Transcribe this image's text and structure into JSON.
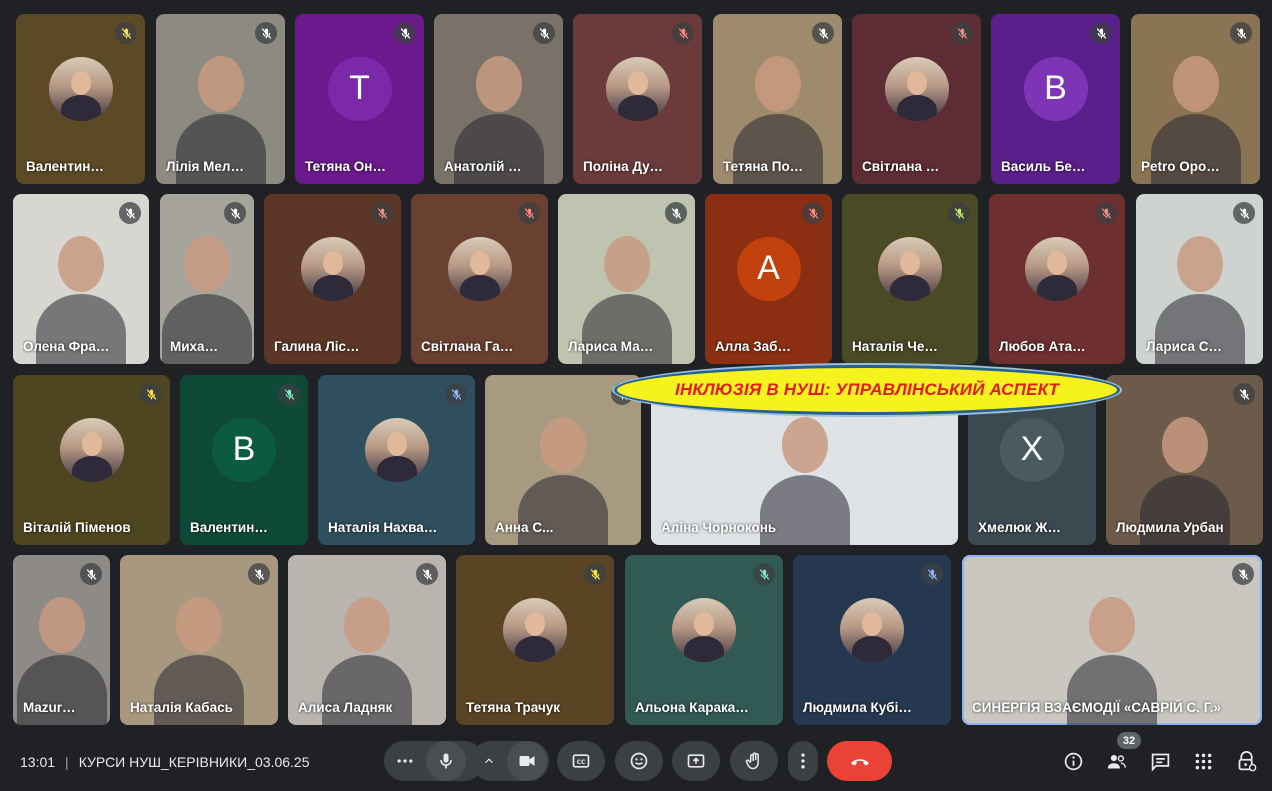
{
  "participants": [
    {
      "name": "Валентина ...",
      "color": "#5b4a25",
      "avatar": "photo-circle",
      "micColor": "#fce34d"
    },
    {
      "name": "Лілія Мельн...",
      "color": "#8d8a82",
      "avatar": "camera",
      "micColor": "#ffffff"
    },
    {
      "name": "Тетяна Оноп...",
      "color": "#6a1a8c",
      "avatar": "letter",
      "letter": "Т",
      "letterColor": "#7b29a8",
      "micColor": "#ffffff"
    },
    {
      "name": "Анатолій По...",
      "color": "#7a7268",
      "avatar": "camera",
      "micColor": "#ffffff"
    },
    {
      "name": "Поліна Дурд...",
      "color": "#6b3a3b",
      "avatar": "photo-circle",
      "micColor": "#f28b82"
    },
    {
      "name": "Тетяна Подо...",
      "color": "#9e8a6c",
      "avatar": "camera",
      "micColor": "#ffffff"
    },
    {
      "name": "Світлана Пе...",
      "color": "#5e2c35",
      "avatar": "photo-circle",
      "micColor": "#f28b82"
    },
    {
      "name": "Василь Безв...",
      "color": "#5a1f8a",
      "avatar": "letter",
      "letter": "В",
      "letterColor": "#7d35b5",
      "micColor": "#ffffff"
    },
    {
      "name": "Petro Opopri...",
      "color": "#8a7454",
      "avatar": "camera",
      "micColor": "#ffffff"
    },
    {
      "name": "Олена Франч...",
      "color": "#d8d6d0",
      "avatar": "camera",
      "micColor": "#ffffff"
    },
    {
      "name": "Михайл...",
      "color": "#a7a49c",
      "avatar": "camera",
      "micColor": "#ffffff"
    },
    {
      "name": "Галина Лісник",
      "color": "#5c3626",
      "avatar": "photo-circle",
      "micColor": "#f28b82"
    },
    {
      "name": "Світлана Гавр...",
      "color": "#6a4030",
      "avatar": "photo-circle",
      "micColor": "#f28b82"
    },
    {
      "name": "Лариса Маль...",
      "color": "#bfc4b0",
      "avatar": "camera",
      "micColor": "#ffffff"
    },
    {
      "name": "Алла Забол...",
      "color": "#8b2e12",
      "avatar": "letter",
      "letter": "А",
      "letterColor": "#c2410c",
      "micColor": "#f28b82"
    },
    {
      "name": "Наталія Черн...",
      "color": "#4a4a25",
      "avatar": "photo-circle",
      "micColor": "#c5e67a"
    },
    {
      "name": "Любов Атама...",
      "color": "#6d2f2f",
      "avatar": "photo-circle",
      "micColor": "#f28b82"
    },
    {
      "name": "Лариса Сид...",
      "color": "#cfd3cf",
      "avatar": "camera",
      "micColor": "#ffffff"
    },
    {
      "name": "Віталій Піменов",
      "color": "#4e4620",
      "avatar": "photo-circle",
      "micColor": "#fce34d"
    },
    {
      "name": "Валентина ...",
      "color": "#0f4a38",
      "avatar": "letter",
      "letter": "В",
      "letterColor": "#0b5b43",
      "micColor": "#81e6c0"
    },
    {
      "name": "Наталія Нахваль...",
      "color": "#2f4f5e",
      "avatar": "photo-circle",
      "micColor": "#8ab4f8"
    },
    {
      "name": "Анна С...",
      "color": "#a89a80",
      "avatar": "camera",
      "micColor": "#ffffff"
    },
    {
      "name": "Аліна Чорноконь",
      "color": "#dfe3e6",
      "avatar": "camera",
      "micColor": "#ffffff"
    },
    {
      "name": "Хмелюк Жа...",
      "color": "#3a4a50",
      "avatar": "letter",
      "letter": "Х",
      "letterColor": "#4b5a60",
      "micColor": "#ffffff"
    },
    {
      "name": "Людмила Урбан",
      "color": "#6c5a4a",
      "avatar": "camera",
      "micColor": "#ffffff"
    },
    {
      "name": "Mazur ...",
      "color": "#8e8a86",
      "avatar": "camera",
      "micColor": "#ffffff"
    },
    {
      "name": "Наталія Кабась",
      "color": "#a89880",
      "avatar": "camera",
      "micColor": "#ffffff"
    },
    {
      "name": "Алиса Ладняк",
      "color": "#b9b4ae",
      "avatar": "camera",
      "micColor": "#ffffff"
    },
    {
      "name": "Тетяна Трачук",
      "color": "#5a4424",
      "avatar": "photo-circle",
      "micColor": "#fce34d"
    },
    {
      "name": "Альона Каракац...",
      "color": "#325a55",
      "avatar": "photo-circle",
      "micColor": "#81e6c0"
    },
    {
      "name": "Людмила Кубіць...",
      "color": "#263850",
      "avatar": "photo-circle",
      "micColor": "#8ab4f8"
    },
    {
      "name": "СИНЕРГІЯ ВЗАЄМОДІЇ «САВРІЙ С. Г.»",
      "color": "#c9c7c0",
      "avatar": "camera",
      "micColor": "#ffffff",
      "active": true
    }
  ],
  "banner": {
    "text": "ІНКЛЮЗІЯ В НУШ: УПРАВЛІНСЬКИЙ АСПЕКТ"
  },
  "meeting": {
    "time": "13:01",
    "separator": "|",
    "title": "КУРСИ НУШ_КЕРІВНИКИ_03.06.25"
  },
  "controls": {
    "more_icon": "more-horiz-icon",
    "mic_icon": "mic-icon",
    "chevron_icon": "chevron-up-icon",
    "camera_icon": "videocam-icon",
    "captions_icon": "closed-caption-icon",
    "emoji_icon": "emoji-icon",
    "present_icon": "present-screen-icon",
    "hand_icon": "raise-hand-icon",
    "more_vert_icon": "more-vert-icon",
    "end_call_icon": "end-call-icon",
    "end_call_color": "#ea4335"
  },
  "right_controls": {
    "people_count": "32"
  }
}
